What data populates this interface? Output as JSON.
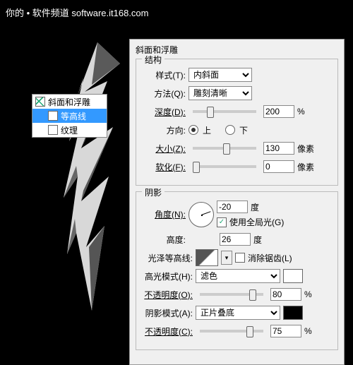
{
  "watermark": "你的 • 软件频道  software.it168.com",
  "effectsList": {
    "i0": "斜面和浮雕",
    "i1": "等高线",
    "i2": "纹理"
  },
  "dialog": {
    "title": "斜面和浮雕",
    "structure": {
      "title": "结构",
      "style_label": "样式(T):",
      "style_value": "内斜面",
      "technique_label": "方法(Q):",
      "technique_value": "雕刻清晰",
      "depth_label": "深度(D):",
      "depth_value": "200",
      "depth_unit": "%",
      "direction_label": "方向:",
      "up": "上",
      "down": "下",
      "size_label": "大小(Z):",
      "size_value": "130",
      "size_unit": "像素",
      "soften_label": "软化(F):",
      "soften_value": "0",
      "soften_unit": "像素"
    },
    "shading": {
      "title": "阴影",
      "angle_label": "角度(N):",
      "angle_value": "-20",
      "angle_unit": "度",
      "global_label": "使用全局光(G)",
      "altitude_label": "高度:",
      "altitude_value": "26",
      "altitude_unit": "度",
      "gloss_label": "光泽等高线:",
      "antialias_label": "消除锯齿(L)",
      "highlight_mode_label": "高光模式(H):",
      "highlight_mode_value": "滤色",
      "highlight_opacity_label": "不透明度(O):",
      "highlight_opacity_value": "80",
      "opacity_unit": "%",
      "shadow_mode_label": "阴影模式(A):",
      "shadow_mode_value": "正片叠底",
      "shadow_opacity_label": "不透明度(C):",
      "shadow_opacity_value": "75"
    }
  }
}
